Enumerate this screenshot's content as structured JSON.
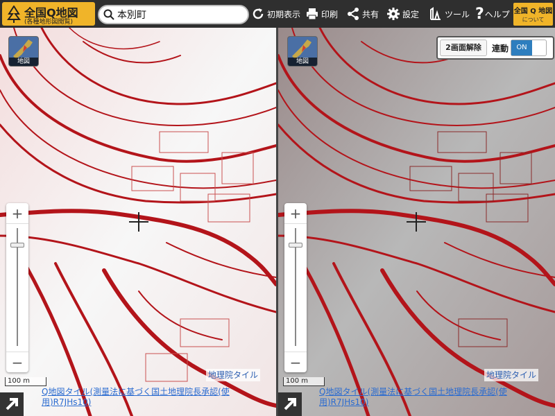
{
  "header": {
    "logo_title": "全国Q地図",
    "logo_subtitle": "(各種地形図閲覧)",
    "search_value": "本別町",
    "tools": [
      {
        "label": "初期表示",
        "icon": "refresh-icon"
      },
      {
        "label": "印刷",
        "icon": "printer-icon"
      },
      {
        "label": "共有",
        "icon": "share-icon"
      },
      {
        "label": "設定",
        "icon": "gear-icon"
      },
      {
        "label": "ツール",
        "icon": "tool-icon"
      },
      {
        "label": "ヘルプ",
        "icon": "help-icon"
      }
    ],
    "about_title": "全国 Q 地図",
    "about_subtitle": "について"
  },
  "left_pane": {
    "layer_label": "地図",
    "zoom_in": "+",
    "zoom_out": "−",
    "scale": "100 m",
    "attribution_tile": "地理院タイル",
    "attribution_link": "Q地図タイル(測量法に基づく国土地理院長承認(使用)R7JHs10)"
  },
  "right_pane": {
    "layer_label": "地図",
    "split_button": "2画面解除",
    "sync_label": "連動",
    "sync_state": "ON",
    "zoom_in": "+",
    "zoom_out": "−",
    "scale": "100 m",
    "attribution_tile": "地理院タイル",
    "attribution_link": "Q地図タイル(測量法に基づく国土地理院長承認(使用)R7JHs10)"
  },
  "colors": {
    "accent": "#f0b429",
    "toolbar": "#2f2f2f",
    "relief_red": "#b3141a",
    "sync_on": "#2e7ebe"
  }
}
